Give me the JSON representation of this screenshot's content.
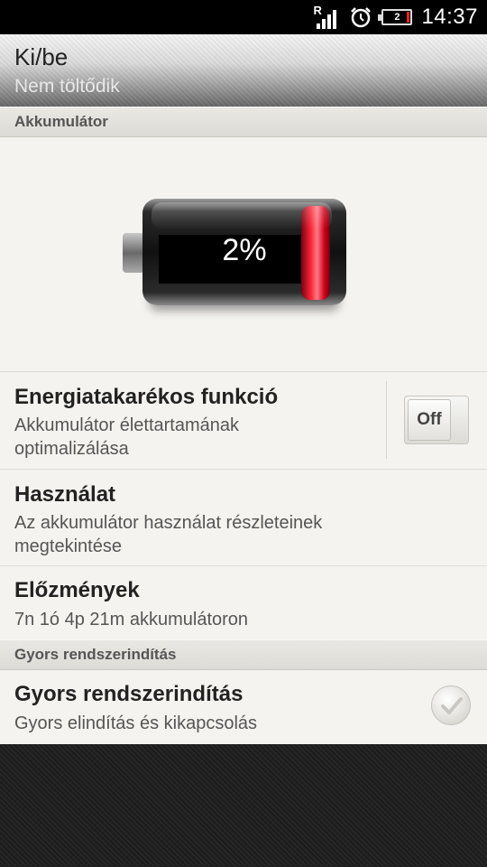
{
  "status_bar": {
    "signal_letter": "R",
    "battery_label": "2",
    "time": "14:37",
    "icons": [
      "signal-icon",
      "alarm-icon",
      "battery-icon"
    ]
  },
  "header": {
    "title": "Ki/be",
    "subtitle": "Nem töltődik"
  },
  "sections": {
    "battery": "Akkumulátor",
    "fast_boot": "Gyors rendszerindítás"
  },
  "battery": {
    "percent_label": "2%",
    "level_fraction": 0.02
  },
  "items": {
    "power_saver": {
      "title": "Energiatakarékos funkció",
      "desc_line1": "Akkumulátor élettartamának",
      "desc_line2": "optimalizálása",
      "toggle_label": "Off"
    },
    "usage": {
      "title": "Használat",
      "desc_line1": "Az akkumulátor használat részleteinek",
      "desc_line2": "megtekintése"
    },
    "history": {
      "title": "Előzmények",
      "desc": "7n 1ó 4p 21m akkumulátoron"
    },
    "fast_boot": {
      "title": "Gyors rendszerindítás",
      "desc": "Gyors elindítás és kikapcsolás",
      "checked": false
    }
  },
  "colors": {
    "battery_red": "#ff2a3a",
    "list_bg": "#f4f3ef",
    "status_bar_bg": "#000000"
  }
}
